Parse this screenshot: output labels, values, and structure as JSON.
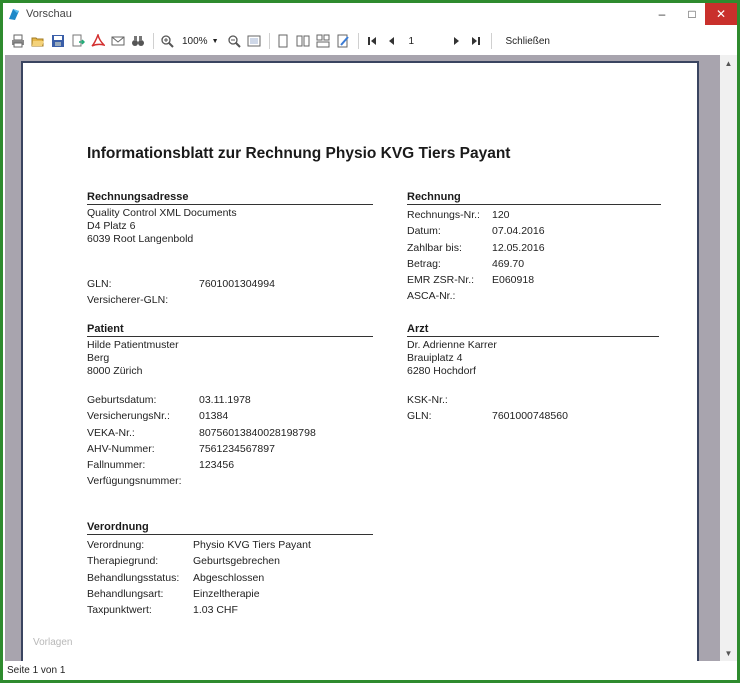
{
  "window": {
    "title": "Vorschau"
  },
  "toolbar": {
    "icons": [
      "print-icon",
      "open-icon",
      "save-icon",
      "export-icon",
      "pdf-icon",
      "email-icon",
      "binoculars-icon",
      "zoom-in-icon",
      "zoom-out-icon",
      "fit-page-icon",
      "single-page-icon",
      "two-pages-icon",
      "multi-page-icon",
      "watermark-icon",
      "first-page-icon",
      "prev-page-icon",
      "next-page-icon",
      "last-page-icon"
    ],
    "zoom_value": "100%",
    "page_value": "1",
    "close_label": "Schließen"
  },
  "document": {
    "title": "Informationsblatt zur Rechnung Physio KVG Tiers Payant",
    "billing_address": {
      "heading": "Rechnungsadresse",
      "lines": [
        "Quality Control XML Documents",
        "D4 Platz 6",
        "6039 Root Langenbold"
      ],
      "gln_label": "GLN:",
      "gln_value": "7601001304994",
      "insurer_gln_label": "Versicherer-GLN:"
    },
    "invoice": {
      "heading": "Rechnung",
      "rows": [
        {
          "label": "Rechnungs-Nr.:",
          "value": "120"
        },
        {
          "label": "Datum:",
          "value": "07.04.2016"
        },
        {
          "label": "Zahlbar bis:",
          "value": "12.05.2016"
        },
        {
          "label": "Betrag:",
          "value": "469.70"
        },
        {
          "label": "EMR ZSR-Nr.:",
          "value": "E060918"
        },
        {
          "label": "ASCA-Nr.:",
          "value": ""
        }
      ]
    },
    "patient": {
      "heading": "Patient",
      "lines": [
        "Hilde Patientmuster",
        "Berg",
        "8000 Zürich"
      ],
      "rows": [
        {
          "label": "Geburtsdatum:",
          "value": "03.11.1978"
        },
        {
          "label": "VersicherungsNr.:",
          "value": "01384"
        },
        {
          "label": "VEKA-Nr.:",
          "value": "80756013840028198798"
        },
        {
          "label": "AHV-Nummer:",
          "value": "7561234567897"
        },
        {
          "label": "Fallnummer:",
          "value": "123456"
        },
        {
          "label": "Verfügungsnummer:",
          "value": ""
        }
      ]
    },
    "doctor": {
      "heading": "Arzt",
      "lines": [
        "Dr. Adrienne Karrer",
        "Brauiplatz 4",
        "6280 Hochdorf"
      ],
      "rows": [
        {
          "label": "KSK-Nr.:",
          "value": ""
        },
        {
          "label": "GLN:",
          "value": "7601000748560"
        }
      ]
    },
    "prescription": {
      "heading": "Verordnung",
      "rows": [
        {
          "label": "Verordnung:",
          "value": "Physio KVG Tiers Payant"
        },
        {
          "label": "Therapiegrund:",
          "value": "Geburtsgebrechen"
        },
        {
          "label": "Behandlungsstatus:",
          "value": "Abgeschlossen"
        },
        {
          "label": "Behandlungsart:",
          "value": "Einzeltherapie"
        },
        {
          "label": "Taxpunktwert:",
          "value": "1.03 CHF"
        }
      ]
    },
    "footer_label": "Vorlagen"
  },
  "status": {
    "page_info": "Seite 1 von 1"
  }
}
